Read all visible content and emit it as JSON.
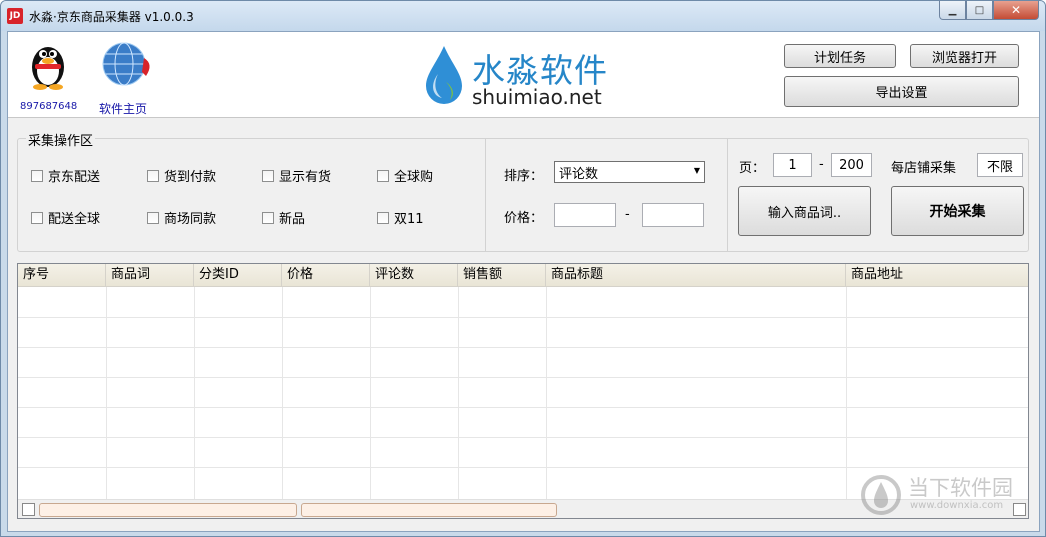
{
  "window": {
    "title": "水淼·京东商品采集器 v1.0.0.3",
    "app_icon_label": "JD",
    "buttons": {
      "minimize": "▁",
      "maximize": "□",
      "close": "✕"
    }
  },
  "header": {
    "qq_number": "897687648",
    "home_link": "软件主页",
    "logo_cn": "水淼软件",
    "logo_en": "shuimiao.net",
    "schedule_button": "计划任务",
    "browser_button": "浏览器打开",
    "export_button": "导出设置"
  },
  "operation": {
    "title": "采集操作区",
    "checkboxes": [
      "京东配送",
      "货到付款",
      "显示有货",
      "全球购",
      "配送全球",
      "商场同款",
      "新品",
      "双11"
    ]
  },
  "sort": {
    "label": "排序：",
    "value": "评论数",
    "price_label": "价格：",
    "price_from": "",
    "price_to": "",
    "dash": "-"
  },
  "pages": {
    "label": "页：",
    "from": "1",
    "dash": "-",
    "to": "200",
    "per_shop_label": "每店铺采集",
    "per_shop_value": "不限"
  },
  "actions": {
    "input_keywords": "输入商品词..",
    "start": "开始采集"
  },
  "table": {
    "columns": [
      "序号",
      "商品词",
      "分类ID",
      "价格",
      "评论数",
      "销售额",
      "商品标题",
      "商品地址"
    ]
  },
  "watermark": {
    "cn": "当下软件园",
    "en": "www.downxia.com"
  },
  "colors": {
    "link": "#1717a8",
    "logo_blue": "#2686c8",
    "titlebar": "#c9daea",
    "close": "#c44c35"
  }
}
